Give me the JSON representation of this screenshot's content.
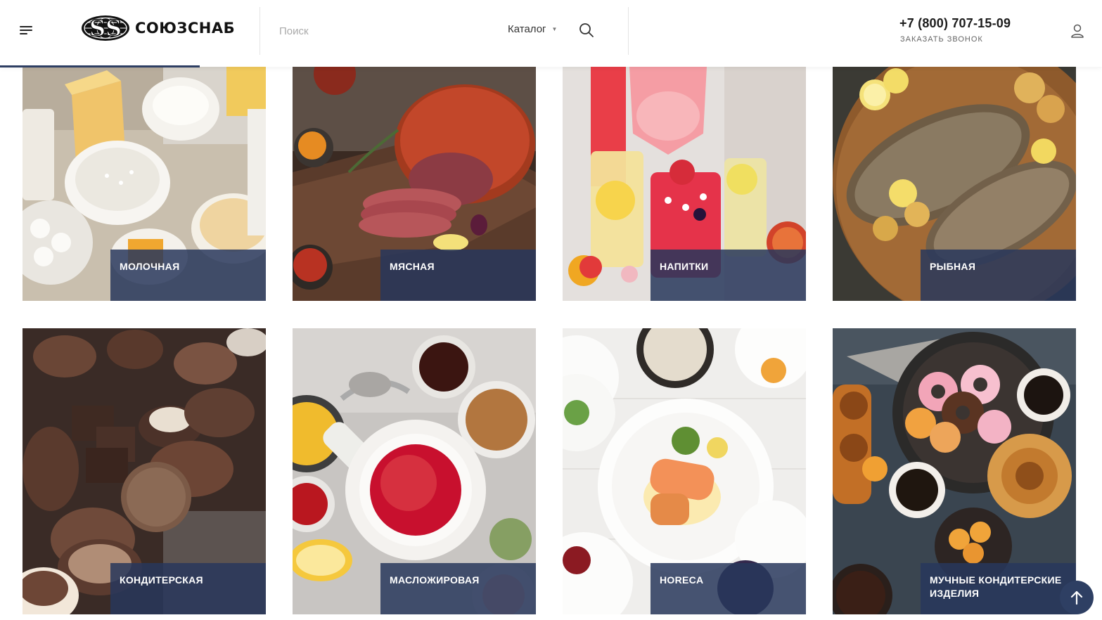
{
  "header": {
    "brand_name": "СОЮЗСНАБ",
    "search_placeholder": "Поиск",
    "catalog_label": "Каталог",
    "phone": "+7 (800) 707-15-09",
    "callback_label": "ЗАКАЗАТЬ ЗВОНОК",
    "accent_color": "#2e3f63"
  },
  "categories": [
    {
      "label": "МОЛОЧНАЯ",
      "icon": "dairy"
    },
    {
      "label": "МЯСНАЯ",
      "icon": "meat"
    },
    {
      "label": "НАПИТКИ",
      "icon": "drinks"
    },
    {
      "label": "РЫБНАЯ",
      "icon": "fish"
    },
    {
      "label": "КОНДИТЕРСКАЯ",
      "icon": "chocolate"
    },
    {
      "label": "МАСЛОЖИРОВАЯ",
      "icon": "sauces"
    },
    {
      "label": "HORECA",
      "icon": "restaurant"
    },
    {
      "label": "МУЧНЫЕ КОНДИТЕРСКИЕ ИЗДЕЛИЯ",
      "icon": "pastry"
    }
  ],
  "icons": {
    "menu": "hamburger-icon",
    "search": "search-icon",
    "profile": "user-icon",
    "scroll_top": "arrow-up-icon"
  }
}
